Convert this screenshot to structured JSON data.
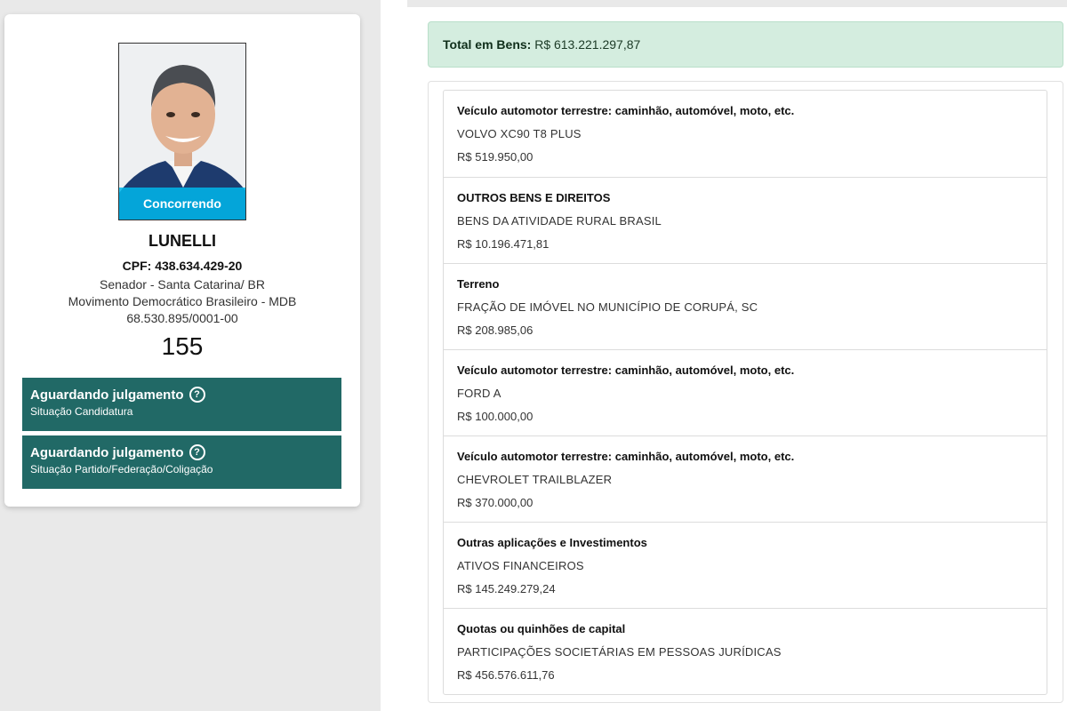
{
  "candidate": {
    "photo_status": "Concorrendo",
    "name": "LUNELLI",
    "cpf": "CPF: 438.634.429-20",
    "office": "Senador - Santa Catarina/ BR",
    "party": "Movimento Democrático Brasileiro - MDB",
    "cnpj": "68.530.895/0001-00",
    "number": "155",
    "status_candidatura": {
      "title": "Aguardando julgamento",
      "subtitle": "Situação Candidatura",
      "icon": "help-circle-icon"
    },
    "status_partido": {
      "title": "Aguardando julgamento",
      "subtitle": "Situação Partido/Federação/Coligação",
      "icon": "help-circle-icon"
    }
  },
  "total": {
    "label": "Total em Bens:",
    "value": "R$ 613.221.297,87"
  },
  "assets": [
    {
      "type": "Veículo automotor terrestre: caminhão, automóvel, moto, etc.",
      "description": "VOLVO XC90 T8 PLUS",
      "value": "R$ 519.950,00"
    },
    {
      "type": "OUTROS BENS E DIREITOS",
      "description": "BENS DA ATIVIDADE RURAL BRASIL",
      "value": "R$ 10.196.471,81"
    },
    {
      "type": "Terreno",
      "description": "FRAÇÃO DE IMÓVEL NO MUNICÍPIO DE CORUPÁ, SC",
      "value": "R$ 208.985,06"
    },
    {
      "type": "Veículo automotor terrestre: caminhão, automóvel, moto, etc.",
      "description": "FORD A",
      "value": "R$ 100.000,00"
    },
    {
      "type": "Veículo automotor terrestre: caminhão, automóvel, moto, etc.",
      "description": "CHEVROLET TRAILBLAZER",
      "value": "R$ 370.000,00"
    },
    {
      "type": "Outras aplicações e Investimentos",
      "description": "ATIVOS FINANCEIROS",
      "value": "R$ 145.249.279,24"
    },
    {
      "type": "Quotas ou quinhões de capital",
      "description": "PARTICIPAÇÕES SOCIETÁRIAS EM PESSOAS JURÍDICAS",
      "value": "R$ 456.576.611,76"
    }
  ],
  "colors": {
    "status_box": "#216966",
    "photo_badge": "#00b8ec",
    "total_box": "#d4eddf"
  }
}
